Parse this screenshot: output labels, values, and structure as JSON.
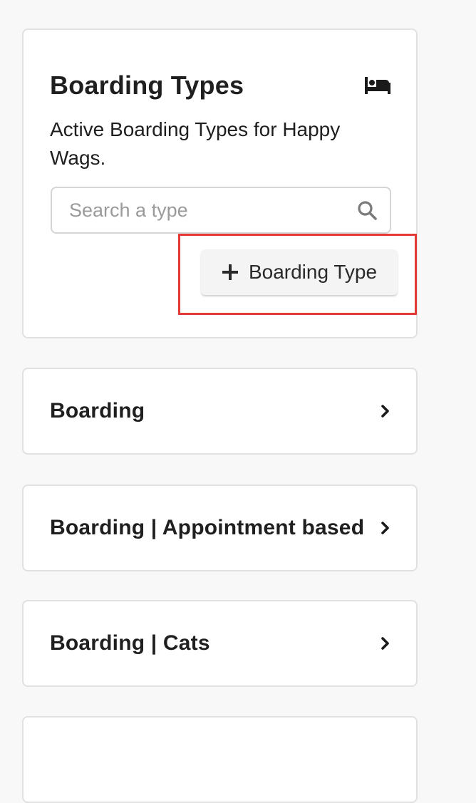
{
  "header": {
    "title": "Boarding Types",
    "icon": "bed-icon",
    "description": "Active Boarding Types for Happy Wags."
  },
  "search": {
    "placeholder": "Search a type",
    "value": "",
    "icon": "search-icon"
  },
  "add_button": {
    "label": "Boarding Type",
    "icon": "plus-icon"
  },
  "highlight_color": "#e53935",
  "boarding_types": [
    {
      "label": "Boarding",
      "icon": "chevron-right-icon"
    },
    {
      "label": "Boarding | Appointment based",
      "icon": "chevron-right-icon"
    },
    {
      "label": "Boarding | Cats",
      "icon": "chevron-right-icon"
    },
    {
      "label": "",
      "icon": ""
    }
  ]
}
